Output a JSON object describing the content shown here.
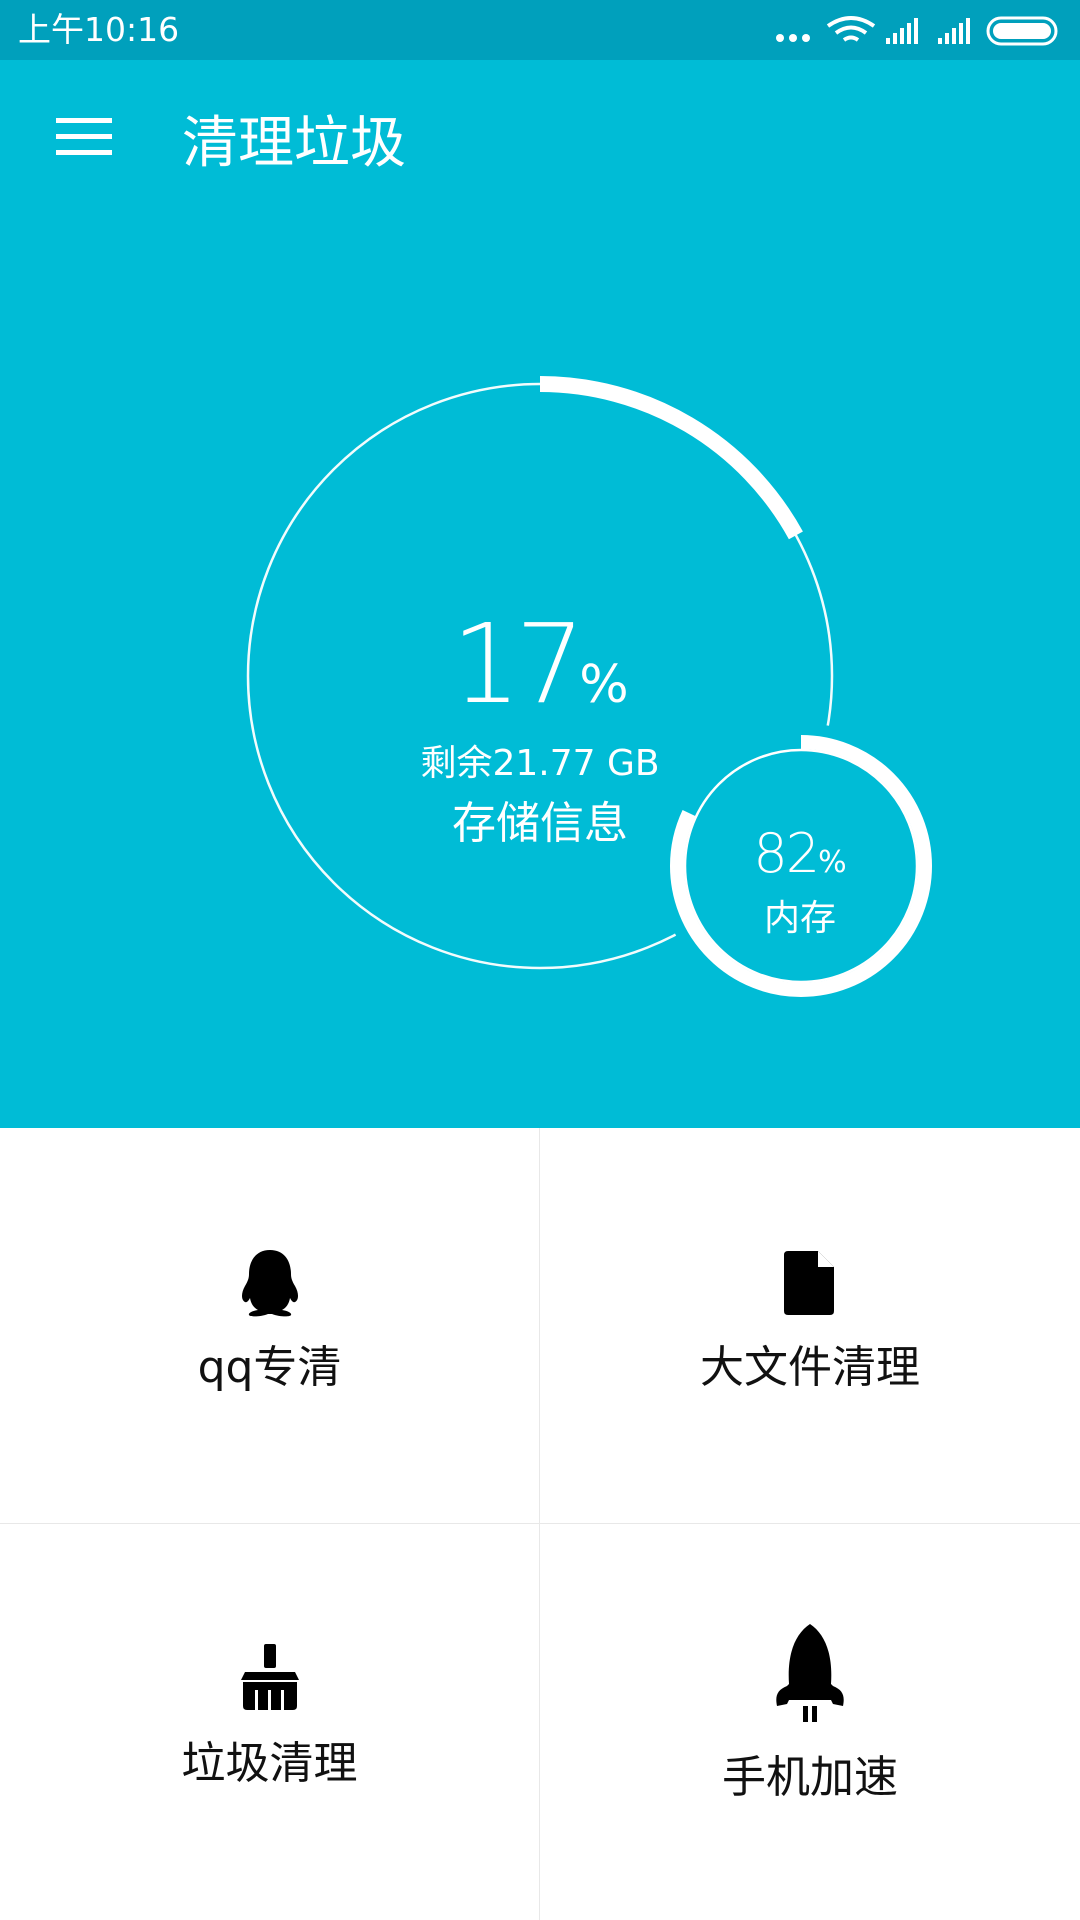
{
  "status_bar": {
    "time": "上午10:16"
  },
  "app_bar": {
    "title": "清理垃圾"
  },
  "storage": {
    "percent": "17",
    "percent_unit": "%",
    "remaining": "剩余21.77 GB",
    "label": "存储信息",
    "arc_fraction": 0.17
  },
  "memory": {
    "percent": "82",
    "percent_unit": "%",
    "label": "内存",
    "arc_fraction": 0.82
  },
  "tiles": [
    {
      "label": "qq专清",
      "icon": "qq-penguin-icon"
    },
    {
      "label": "大文件清理",
      "icon": "file-icon"
    },
    {
      "label": "垃圾清理",
      "icon": "broom-icon"
    },
    {
      "label": "手机加速",
      "icon": "rocket-icon"
    }
  ],
  "colors": {
    "status_bar": "#00A0BC",
    "primary": "#00BCD6",
    "text_light": "#ffffff",
    "text_dark": "#111111"
  }
}
